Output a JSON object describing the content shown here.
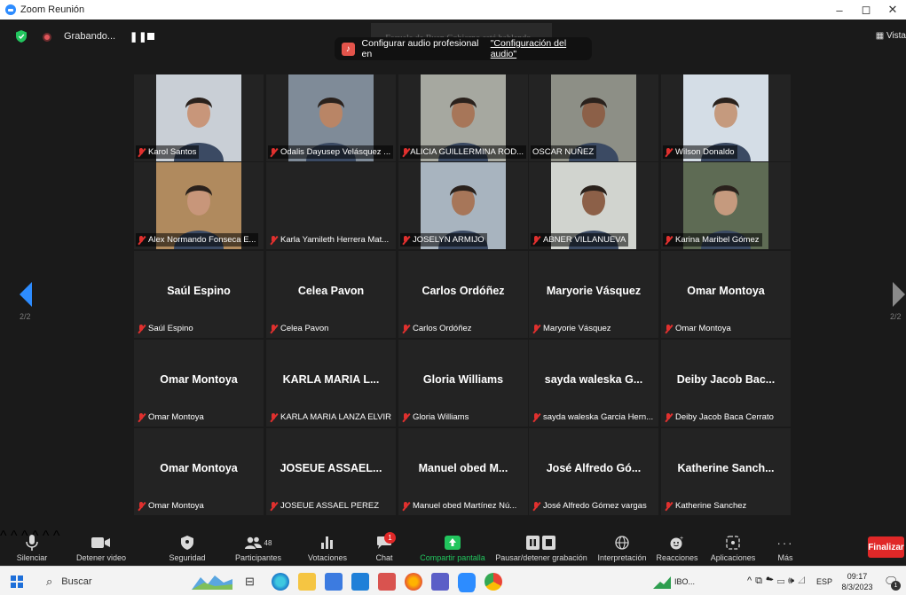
{
  "window": {
    "title": "Zoom Reunión",
    "minimize": "–",
    "maximize": "◻",
    "close": "✕"
  },
  "topbar": {
    "recording_label": "Grabando...",
    "pause_label": "❚❚",
    "speaking_banner": "Escuela de Buen Gobierno está hablando...",
    "toast_text": "Configurar audio profesional en",
    "toast_link": "\"Configuración del audio\"",
    "view_label": "Vista",
    "page_left": "2/2",
    "page_right": "2/2"
  },
  "participants": [
    {
      "label": "Karol Santos",
      "big": "",
      "video": true,
      "label_bg": true
    },
    {
      "label": "Odalis Dayusep Velásquez ...",
      "big": "",
      "video": true,
      "label_bg": true
    },
    {
      "label": "ALICIA GUILLERMINA ROD...",
      "big": "",
      "video": true,
      "label_bg": true
    },
    {
      "label": "OSCAR NUÑEZ",
      "big": "",
      "video": true,
      "label_bg": true,
      "no_mute": true
    },
    {
      "label": "Wilson Donaldo",
      "big": "",
      "video": true,
      "label_bg": true
    },
    {
      "label": "Alex Normando Fonseca E...",
      "big": "",
      "video": true,
      "label_bg": true
    },
    {
      "label": "Karla Yamileth Herrera Mat...",
      "big": "",
      "video": false,
      "label_bg": false
    },
    {
      "label": "JOSELYN ARMIJO",
      "big": "",
      "video": true,
      "label_bg": true
    },
    {
      "label": "ABNER VILLANUEVA",
      "big": "",
      "video": true,
      "label_bg": true
    },
    {
      "label": "Karina Maribel Gómez",
      "big": "",
      "video": true,
      "label_bg": true
    },
    {
      "label": "Saúl Espino",
      "big": "Saúl Espino",
      "video": false,
      "label_bg": false
    },
    {
      "label": "Celea Pavon",
      "big": "Celea Pavon",
      "video": false,
      "label_bg": false
    },
    {
      "label": "Carlos Ordóñez",
      "big": "Carlos Ordóñez",
      "video": false,
      "label_bg": false
    },
    {
      "label": "Maryorie Vásquez",
      "big": "Maryorie Vásquez",
      "video": false,
      "label_bg": false
    },
    {
      "label": "Omar Montoya",
      "big": "Omar Montoya",
      "video": false,
      "label_bg": false
    },
    {
      "label": "Omar Montoya",
      "big": "Omar Montoya",
      "video": false,
      "label_bg": false
    },
    {
      "label": "KARLA MARIA LANZA ELVIR",
      "big": "KARLA MARIA L...",
      "video": false,
      "label_bg": false
    },
    {
      "label": "Gloria Williams",
      "big": "Gloria Williams",
      "video": false,
      "label_bg": false
    },
    {
      "label": "sayda waleska Garcia Hern...",
      "big": "sayda waleska G...",
      "video": false,
      "label_bg": false
    },
    {
      "label": "Deiby Jacob Baca Cerrato",
      "big": "Deiby Jacob Bac...",
      "video": false,
      "label_bg": false
    },
    {
      "label": "Omar Montoya",
      "big": "Omar Montoya",
      "video": false,
      "label_bg": false
    },
    {
      "label": "JOSEUE ASSAEL PEREZ",
      "big": "JOSEUE ASSAEL...",
      "video": false,
      "label_bg": false
    },
    {
      "label": "Manuel obed Martínez Nú...",
      "big": "Manuel obed M...",
      "video": false,
      "label_bg": false
    },
    {
      "label": "José Alfredo Gómez vargas",
      "big": "José Alfredo Gó...",
      "video": false,
      "label_bg": false
    },
    {
      "label": "Katherine Sanchez",
      "big": "Katherine Sanch...",
      "video": false,
      "label_bg": false
    }
  ],
  "toolbar": {
    "mute": "Silenciar",
    "video": "Detener video",
    "security": "Seguridad",
    "participants": "Participantes",
    "participants_count": "48",
    "polls": "Votaciones",
    "chat": "Chat",
    "chat_badge": "1",
    "share": "Compartir pantalla",
    "record": "Pausar/detener grabación",
    "interpretation": "Interpretación",
    "reactions": "Reacciones",
    "apps": "Aplicaciones",
    "more": "Más",
    "end": "Finalizar"
  },
  "taskbar": {
    "search_placeholder": "Buscar",
    "ticker": "IBO...",
    "language": "ESP",
    "time": "09:17",
    "date": "8/3/2023",
    "notif_count": "1"
  },
  "colors": {
    "accent": "#2d8cff",
    "mute_red": "#e0302e",
    "end_red": "#e02828",
    "share_green": "#22c55e"
  }
}
